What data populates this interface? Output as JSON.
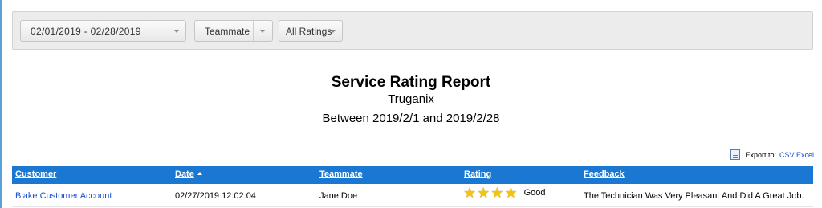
{
  "filters": {
    "date_range": "02/01/2019 - 02/28/2019",
    "teammate": "Teammate",
    "ratings": "All Ratings"
  },
  "report": {
    "title": "Service Rating Report",
    "company": "Truganix",
    "range": "Between 2019/2/1 and 2019/2/28"
  },
  "export": {
    "label": "Export to:",
    "link": "CSV Excel"
  },
  "table": {
    "headers": {
      "customer": "Customer",
      "date": "Date",
      "teammate": "Teammate",
      "rating": "Rating",
      "feedback": "Feedback"
    },
    "rows": [
      {
        "customer": "Blake Customer Account",
        "date": "02/27/2019 12:02:04",
        "teammate": "Jane Doe",
        "stars": 4,
        "rating": "Good",
        "feedback": "The Technician Was Very Pleasant And Did A Great Job."
      }
    ]
  },
  "colors": {
    "header_bar": "#1a78d2",
    "link": "#1a4fd0",
    "star": "#f1c40f"
  },
  "icons": [
    "caret-down-icon",
    "sort-ascending-icon",
    "export-document-icon",
    "star-icon"
  ]
}
